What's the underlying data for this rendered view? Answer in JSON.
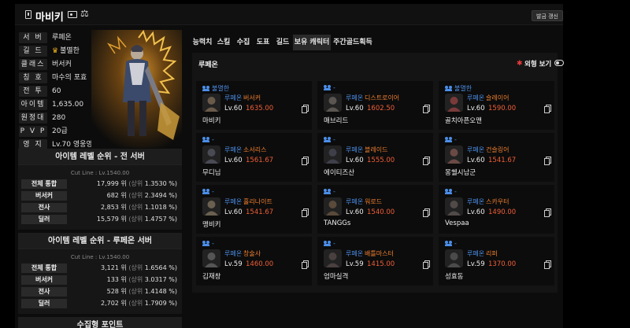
{
  "header": {
    "title": "마비키",
    "refresh_label": "발금 갱신"
  },
  "profile": {
    "rows": [
      {
        "label": "서 버",
        "value": "루페온"
      },
      {
        "label": "길 드",
        "value": "불멸한"
      },
      {
        "label": "클래스",
        "value": "버서커"
      },
      {
        "label": "칭 호",
        "value": "마수의 포효"
      },
      {
        "label": "전 투",
        "value": "60"
      },
      {
        "label": "아이템",
        "value": "1,635.00"
      },
      {
        "label": "원정대",
        "value": "280"
      },
      {
        "label": "P V P",
        "value": "20급"
      },
      {
        "label": "영 지",
        "value": "Lv.70 영웅영지"
      }
    ]
  },
  "rank_all": {
    "title": "아이템 레벨 순위 - 전 서버",
    "cut": "Cut Line : Lv.1540.00",
    "rows": [
      {
        "label": "전체 통합",
        "value": "17,999 위",
        "sub": "(상위",
        "pct": "1.3530 %)"
      },
      {
        "label": "버서커",
        "value": "682 위",
        "sub": "(상위",
        "pct": "2.3494 %)"
      },
      {
        "label": "전사",
        "value": "2,853 위",
        "sub": "(상위",
        "pct": "1.1018 %)"
      },
      {
        "label": "딜러",
        "value": "15,579 위",
        "sub": "(상위",
        "pct": "1.4757 %)"
      }
    ]
  },
  "rank_server": {
    "title": "아이템 레벨 순위 - 루페온 서버",
    "cut": "Cut Line : Lv.1540.00",
    "rows": [
      {
        "label": "전체 통합",
        "value": "3,121 위",
        "sub": "(상위",
        "pct": "1.6564 %)"
      },
      {
        "label": "버서커",
        "value": "133 위",
        "sub": "(상위",
        "pct": "3.0317 %)"
      },
      {
        "label": "전사",
        "value": "528 위",
        "sub": "(상위",
        "pct": "1.4148 %)"
      },
      {
        "label": "딜러",
        "value": "2,702 위",
        "sub": "(상위",
        "pct": "1.7909 %)"
      }
    ]
  },
  "rank_next": {
    "title": "수집형 포인트"
  },
  "tabs": [
    "능력치",
    "스킬",
    "수집",
    "도표",
    "길드",
    "보유 캐릭터",
    "주간골드획득"
  ],
  "active_tab": "보유 캐릭터",
  "panel": {
    "server": "루페온",
    "costume_label": "외형 보기"
  },
  "characters": [
    {
      "guild": "불멸한",
      "server": "루페온",
      "class": "버서커",
      "level": "Lv.60",
      "item_level": "1635.00",
      "name": "마비키",
      "color": "#6a5a4a"
    },
    {
      "guild": "-",
      "server": "루페온",
      "class": "디스트로이어",
      "level": "Lv.60",
      "item_level": "1602.50",
      "name": "매브리드",
      "color": "#5a5550"
    },
    {
      "guild": "불멸한",
      "server": "루페온",
      "class": "슬레이어",
      "level": "Lv.60",
      "item_level": "1590.00",
      "name": "골치아픈오맨",
      "color": "#7a3a3a"
    },
    {
      "guild": "-",
      "server": "루페온",
      "class": "소서리스",
      "level": "Lv.60",
      "item_level": "1561.67",
      "name": "무디님",
      "color": "#4a4a55"
    },
    {
      "guild": "-",
      "server": "루페온",
      "class": "블레이드",
      "level": "Lv.60",
      "item_level": "1555.00",
      "name": "에이티즈산",
      "color": "#3f3f4a"
    },
    {
      "guild": "-",
      "server": "루페온",
      "class": "건슬링어",
      "level": "Lv.60",
      "item_level": "1541.67",
      "name": "몽쉘시남군",
      "color": "#6a4a45"
    },
    {
      "guild": "-",
      "server": "루페온",
      "class": "홀리나이트",
      "level": "Lv.60",
      "item_level": "1541.67",
      "name": "맹비키",
      "color": "#6a6050"
    },
    {
      "guild": "-",
      "server": "루페온",
      "class": "워로드",
      "level": "Lv.60",
      "item_level": "1540.00",
      "name": "TANGGs",
      "color": "#5a4a3a"
    },
    {
      "guild": "-",
      "server": "루페온",
      "class": "스카우터",
      "level": "Lv.60",
      "item_level": "1490.00",
      "name": "Vespaa",
      "color": "#504a48"
    },
    {
      "guild": "-",
      "server": "루페온",
      "class": "창술사",
      "level": "Lv.59",
      "item_level": "1460.00",
      "name": "김재창",
      "color": "#555555"
    },
    {
      "guild": "-",
      "server": "루페온",
      "class": "배틀마스터",
      "level": "Lv.59",
      "item_level": "1415.00",
      "name": "엄마실격",
      "color": "#4a4040"
    },
    {
      "guild": "-",
      "server": "루페온",
      "class": "리퍼",
      "level": "Lv.59",
      "item_level": "1370.00",
      "name": "성효동",
      "color": "#4a4a4a"
    }
  ]
}
